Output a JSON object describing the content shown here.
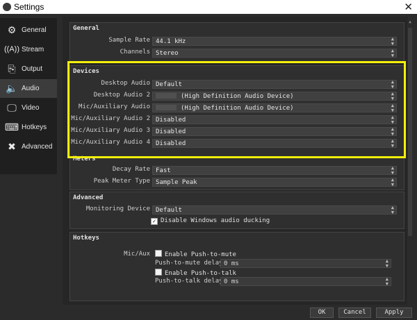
{
  "window": {
    "title": "Settings",
    "close": "✕"
  },
  "sidebar": {
    "items": [
      {
        "label": "General",
        "icon": "gear-icon"
      },
      {
        "label": "Stream",
        "icon": "broadcast-icon"
      },
      {
        "label": "Output",
        "icon": "output-icon"
      },
      {
        "label": "Audio",
        "icon": "speaker-icon"
      },
      {
        "label": "Video",
        "icon": "monitor-icon"
      },
      {
        "label": "Hotkeys",
        "icon": "keyboard-icon"
      },
      {
        "label": "Advanced",
        "icon": "wrench-screwdriver-icon"
      }
    ],
    "active": "Audio"
  },
  "general": {
    "title": "General",
    "sample_rate_label": "Sample Rate",
    "sample_rate_value": "44.1 kHz",
    "channels_label": "Channels",
    "channels_value": "Stereo"
  },
  "devices": {
    "title": "Devices",
    "rows": [
      {
        "label": "Desktop Audio",
        "value": "Default"
      },
      {
        "label": "Desktop Audio 2",
        "value": "(High Definition Audio Device)"
      },
      {
        "label": "Mic/Auxiliary Audio",
        "value": "(High Definition Audio Device)"
      },
      {
        "label": "Mic/Auxiliary Audio 2",
        "value": "Disabled"
      },
      {
        "label": "Mic/Auxiliary Audio 3",
        "value": "Disabled"
      },
      {
        "label": "Mic/Auxiliary Audio 4",
        "value": "Disabled"
      }
    ]
  },
  "meters": {
    "title": "Meters",
    "decay_rate_label": "Decay Rate",
    "decay_rate_value": "Fast",
    "peak_meter_label": "Peak Meter Type",
    "peak_meter_value": "Sample Peak"
  },
  "advanced": {
    "title": "Advanced",
    "monitoring_label": "Monitoring Device",
    "monitoring_value": "Default",
    "ducking_label": "Disable Windows audio ducking",
    "ducking_checked": true
  },
  "hotkeys": {
    "title": "Hotkeys",
    "source_label": "Mic/Aux",
    "push_to_mute_label": "Enable Push-to-mute",
    "push_to_mute_delay_label": "Push-to-mute delay",
    "push_to_mute_delay_value": "0 ms",
    "push_to_talk_label": "Enable Push-to-talk",
    "push_to_talk_delay_label": "Push-to-talk delay",
    "push_to_talk_delay_value": "0 ms"
  },
  "buttons": {
    "ok": "OK",
    "cancel": "Cancel",
    "apply": "Apply"
  },
  "colors": {
    "highlight": "#f3f00a",
    "background": "#2b2b2b",
    "sidebar": "#1f1f1f"
  }
}
